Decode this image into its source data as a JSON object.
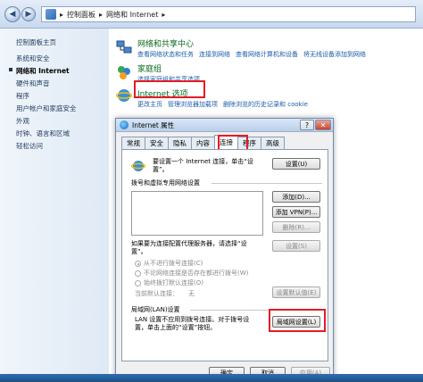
{
  "address": {
    "back": "◀",
    "forward": "▶",
    "crumbs": [
      "控制面板",
      "网络和 Internet"
    ],
    "sep": "▸"
  },
  "sidebar": {
    "items": [
      {
        "label": "控制面板主页",
        "current": false
      },
      {
        "label": "系统和安全",
        "current": false
      },
      {
        "label": "网络和 Internet",
        "current": true
      },
      {
        "label": "硬件和声音",
        "current": false
      },
      {
        "label": "程序",
        "current": false
      },
      {
        "label": "用户帐户和家庭安全",
        "current": false
      },
      {
        "label": "外观",
        "current": false
      },
      {
        "label": "时钟、语言和区域",
        "current": false
      },
      {
        "label": "轻松访问",
        "current": false
      }
    ]
  },
  "categories": [
    {
      "title": "网络和共享中心",
      "links": [
        "查看网络状态和任务",
        "连接到网络",
        "查看网络计算机和设备",
        "将无线设备添加到网络"
      ]
    },
    {
      "title": "家庭组",
      "links": [
        "选择家庭组和共享选项"
      ]
    },
    {
      "title": "Internet 选项",
      "links": [
        "更改主页",
        "管理浏览器加载项",
        "删除浏览的历史记录和 cookie"
      ]
    }
  ],
  "dialog": {
    "title": "Internet 属性",
    "help_btn": "?",
    "close_btn": "✕",
    "tabs": [
      "常规",
      "安全",
      "隐私",
      "内容",
      "连接",
      "程序",
      "高级"
    ],
    "active_tab": 4,
    "setup_text": [
      "要设置一个 Internet 连接，单击“设",
      "置”。"
    ],
    "setup_btn": "设置(U)",
    "dialup_group": "拨号和虚拟专用网络设置",
    "add_btn": "添加(D)...",
    "add_vpn_btn": "添加 VPN(P)...",
    "remove_btn": "删除(R)...",
    "proxy_text": [
      "如果要为连接配置代理服务器，请选择“设",
      "置”。"
    ],
    "settings_btn": "设置(S)",
    "radios": [
      "从不进行拨号连接(C)",
      "不论网络连接是否存在都进行拨号(W)",
      "始终拨打默认连接(O)"
    ],
    "current_default_label": "当前默认连接：",
    "current_default_value": "无",
    "set_default_btn": "设置默认值(E)",
    "lan_group": "局域网(LAN)设置",
    "lan_text": [
      "LAN 设置不应用到拨号连接。对于拨号设",
      "置，单击上面的“设置”按钮。"
    ],
    "lan_btn": "局域网设置(L)",
    "ok_btn": "确定",
    "cancel_btn": "取消",
    "apply_btn": "应用(A)"
  },
  "colors": {
    "accent": "#1a5ca8",
    "category_title": "#0a6b20",
    "highlight": "#e51c23"
  }
}
